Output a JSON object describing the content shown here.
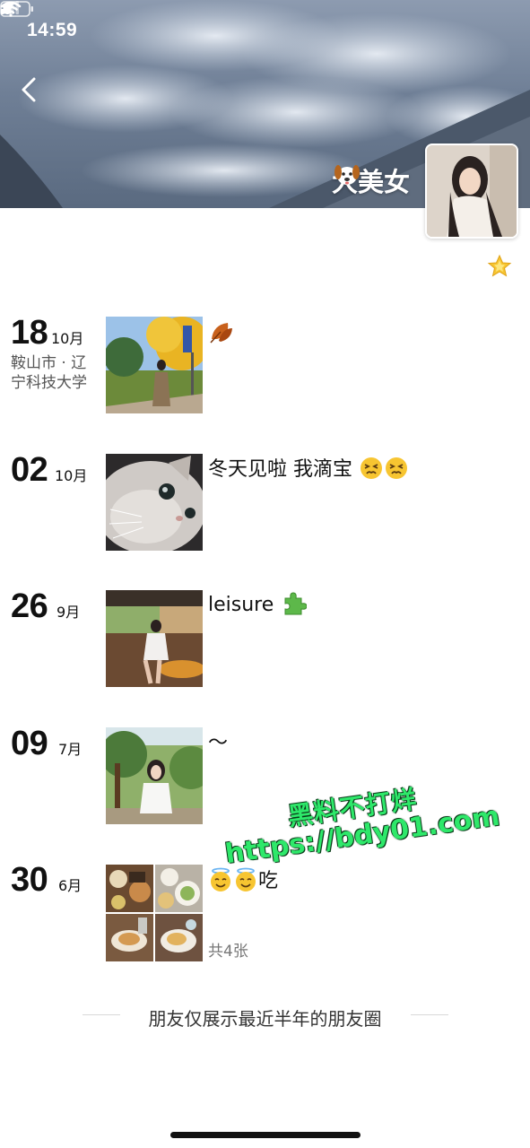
{
  "status_bar": {
    "time": "14:59"
  },
  "profile": {
    "nickname": "大美女"
  },
  "posts": [
    {
      "day": "18",
      "month": "10月",
      "location": "鞍山市 · 辽宁科技大学",
      "text": ""
    },
    {
      "day": "02",
      "month": "10月",
      "text": "冬天见啦 我滴宝"
    },
    {
      "day": "26",
      "month": "9月",
      "text": "leisure"
    },
    {
      "day": "09",
      "month": "7月",
      "text": "～"
    },
    {
      "day": "30",
      "month": "6月",
      "text": "吃",
      "photo_count": "共4张"
    }
  ],
  "footer": {
    "note": "朋友仅展示最近半年的朋友圈"
  },
  "watermark": {
    "line1": "黑料不打烊",
    "line2": "https://bdy01.com"
  }
}
